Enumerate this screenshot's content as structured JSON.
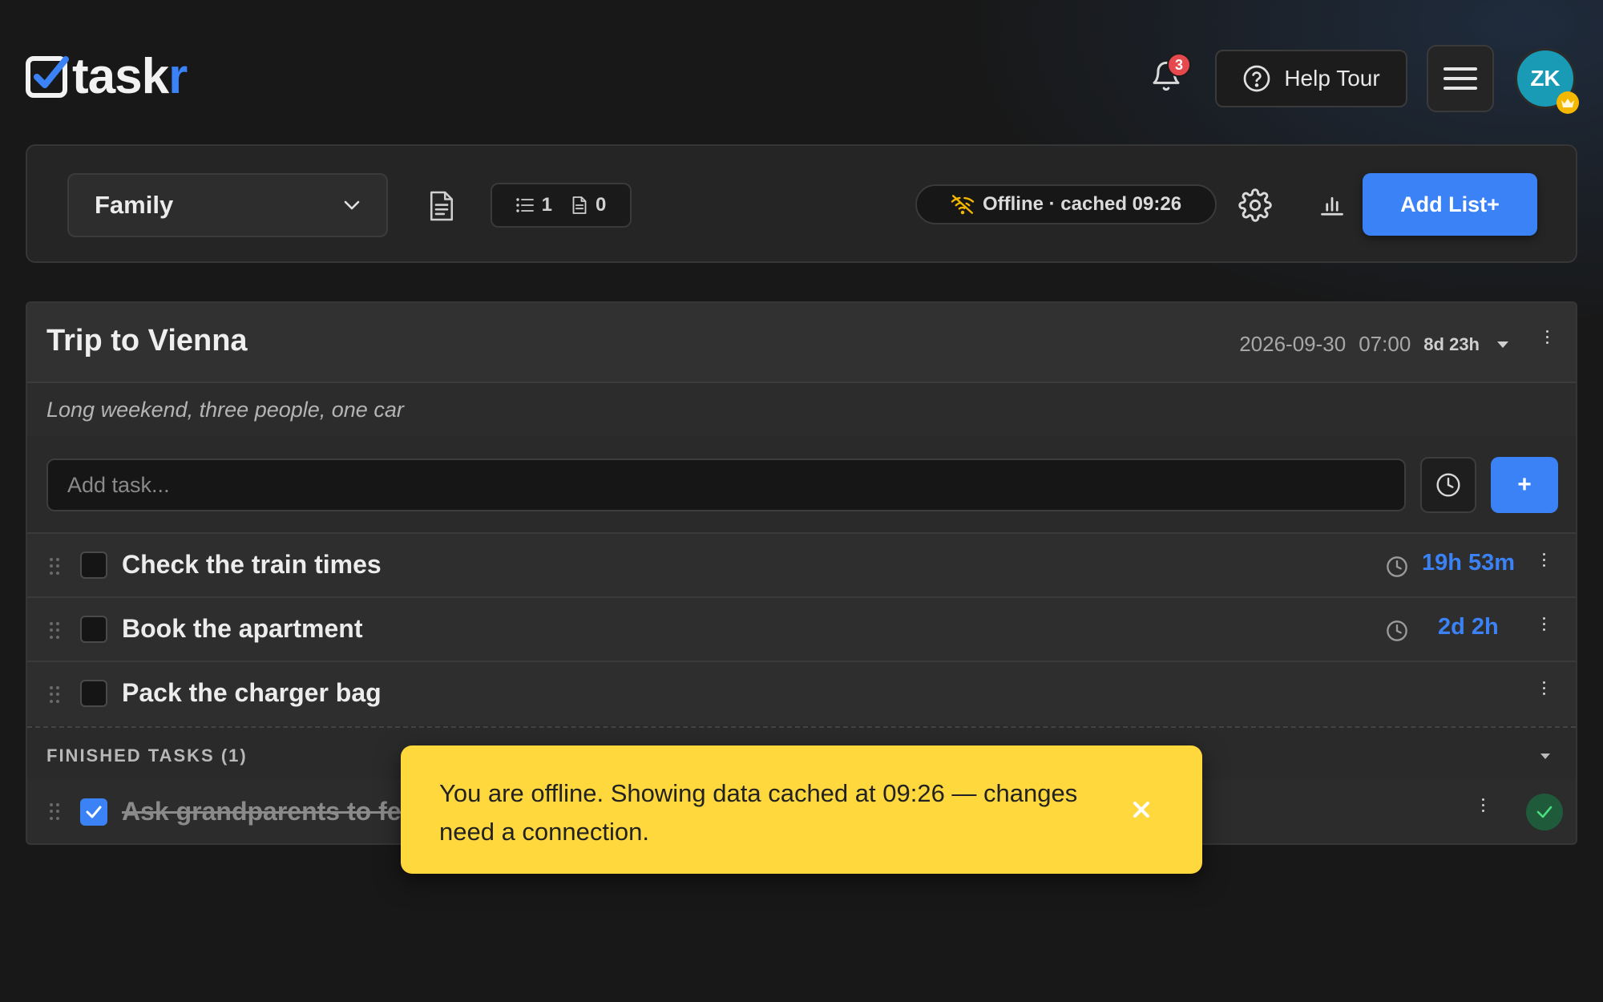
{
  "app": {
    "logo_text_main": "task",
    "logo_text_accent": "r"
  },
  "header": {
    "notification_count": "3",
    "help_label": "Help Tour",
    "avatar_initials": "ZK"
  },
  "toolbar": {
    "selected_list": "Family",
    "lists_count": "1",
    "notes_count": "0",
    "offline_status": "Offline · cached 09:26",
    "add_list_label": "Add List+"
  },
  "list": {
    "title": "Trip to Vienna",
    "due_date": "2026-09-30",
    "due_time": "07:00",
    "time_left": "8d 23h",
    "description": "Long weekend, three people, one car",
    "add_task_placeholder": "Add task...",
    "add_task_button": "+",
    "tasks": [
      {
        "title": "Check the train times",
        "duration": "19h 53m",
        "checked": false
      },
      {
        "title": "Book the apartment",
        "duration": "2d 2h",
        "checked": false
      },
      {
        "title": "Pack the charger bag",
        "duration": "",
        "checked": false
      }
    ],
    "finished_label": "FINISHED TASKS (1)",
    "finished_tasks": [
      {
        "title": "Ask grandparents to fe",
        "checked": true
      }
    ]
  },
  "toast": {
    "message": "You are offline. Showing data cached at 09:26 — changes need a connection."
  },
  "colors": {
    "accent": "#3b82f6",
    "background": "#181818",
    "toast": "#ffd83d",
    "badge": "#e5484d",
    "avatar": "#1a9bb5"
  },
  "icons": {
    "logo": "checkbox-logo-icon",
    "notifications": "bell-icon",
    "help": "question-circle-icon",
    "menu": "hamburger-icon",
    "avatar_badge": "crown-icon",
    "document": "document-icon",
    "offline": "wifi-off-icon",
    "settings": "gear-icon",
    "stats": "bar-chart-icon",
    "time": "clock-icon",
    "close": "close-icon"
  }
}
